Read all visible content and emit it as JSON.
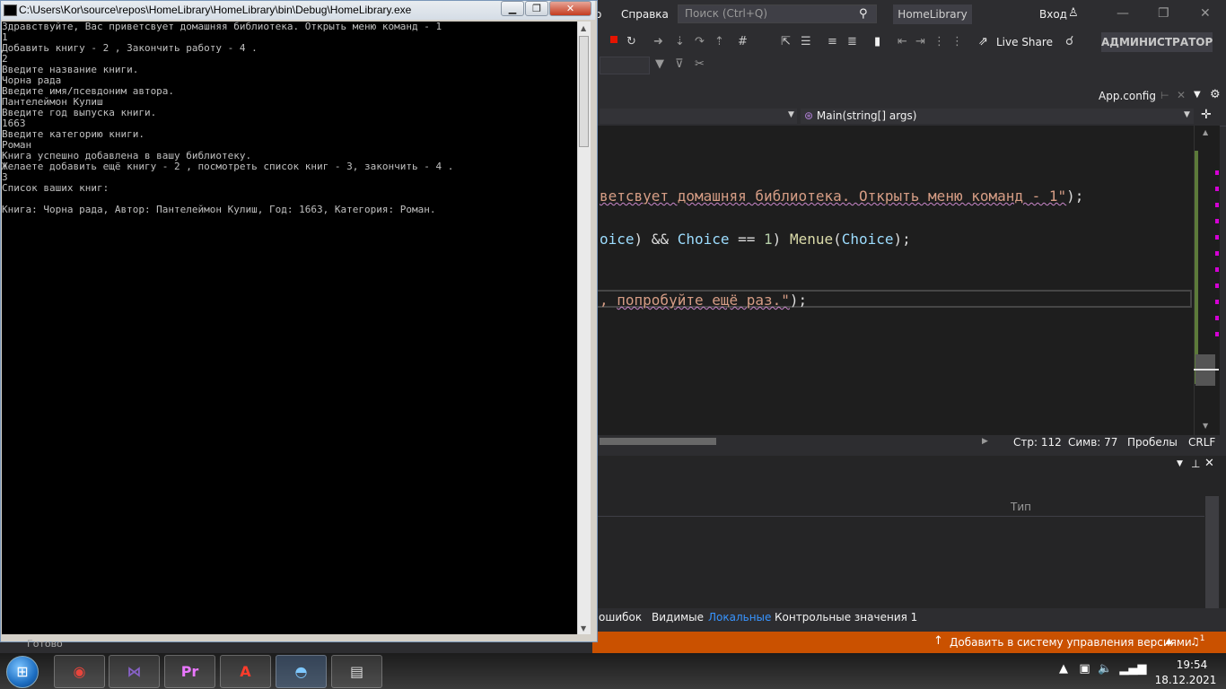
{
  "vs": {
    "menu_help": "Справка",
    "menu_partial": "о",
    "search_placeholder": "Поиск (Ctrl+Q)",
    "project_name": "HomeLibrary",
    "sign_in": "Вход",
    "live_share": "Live Share",
    "admin_badge": "АДМИНИСТРАТОР",
    "doc_tab": "App.config",
    "nav_method": "Main(string[] args)",
    "code_line1_str": "ветсвует домашняя библиотека. Открыть меню команд - 1\"",
    "code_line1_end": ");",
    "code_line2_a": "oice",
    "code_line2_b": ") && ",
    "code_line2_var": "Choice",
    "code_line2_c": " == ",
    "code_line2_num": "1",
    "code_line2_d": ") ",
    "code_line2_fn": "Menue",
    "code_line2_e": "(",
    "code_line2_var2": "Choice",
    "code_line2_f": ");",
    "code_line3_a": ", ",
    "code_line3_str": "попробуйте ещё раз.\"",
    "code_line3_end": ");",
    "status_line": "Стр: 112",
    "status_col": "Симв: 77",
    "status_spaces": "Пробелы",
    "status_crlf": "CRLF",
    "panel_col_type": "Тип",
    "tabs": [
      "ошибок",
      "Видимые",
      "Локальные",
      "Контрольные значения 1"
    ],
    "status_scm": "Добавить в систему управления версиями",
    "notifications": "1"
  },
  "console": {
    "title": "C:\\Users\\Kor\\source\\repos\\HomeLibrary\\HomeLibrary\\bin\\Debug\\HomeLibrary.exe",
    "lines": [
      "Здравствуйте, Вас приветсвует домашняя библиотека. Открыть меню команд - 1",
      "1",
      "Добавить книгу - 2 , Закончить работу - 4 .",
      "2",
      "Введите название книги.",
      "Чорна рада",
      "Введите имя/псевдоним автора.",
      "Пантелеймон Кулиш",
      "Введите год выпуска книги.",
      "1663",
      "Введите категорию книги.",
      "Роман",
      "Книга успешно добавлена в вашу библиотеку.",
      "Желаете добавить ещё книгу - 2 , посмотреть список книг - 3, закончить - 4 .",
      "3",
      "Список ваших книг:",
      "",
      "Книга: Чорна рада, Автор: Пантелеймон Кулиш, Год: 1663, Категория: Роман."
    ],
    "status_text": "Готово"
  },
  "taskbar": {
    "apps": [
      {
        "name": "chrome",
        "glyph": "◉",
        "color": "#e8453c"
      },
      {
        "name": "visual-studio",
        "glyph": "⋈",
        "color": "#8661c5"
      },
      {
        "name": "premiere",
        "glyph": "Pr",
        "color": "#ea77ff"
      },
      {
        "name": "acrobat",
        "glyph": "A",
        "color": "#ff3c2b"
      },
      {
        "name": "app5",
        "glyph": "◓",
        "color": "#7ec8ff"
      },
      {
        "name": "app6",
        "glyph": "▤",
        "color": "#dddddd"
      }
    ],
    "time": "19:54",
    "date": "18.12.2021"
  }
}
